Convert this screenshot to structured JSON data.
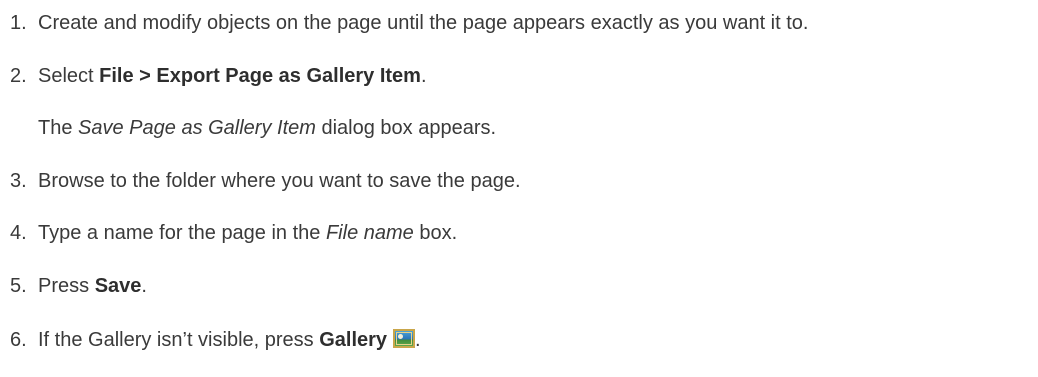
{
  "steps": [
    {
      "number": "1.",
      "text": "Create and modify objects on the page until the page appears exactly as you want it to."
    },
    {
      "number": "2.",
      "prefix": "Select ",
      "bold": "File > Export Page as Gallery Item",
      "suffix": ".",
      "note_prefix": "The ",
      "note_italic": "Save Page as Gallery Item",
      "note_suffix": " dialog box appears."
    },
    {
      "number": "3.",
      "text": "Browse to the folder where you want to save the page."
    },
    {
      "number": "4.",
      "prefix": "Type a name for the page in the ",
      "italic": "File name",
      "suffix": " box."
    },
    {
      "number": "5.",
      "prefix": "Press ",
      "bold": "Save",
      "suffix": "."
    },
    {
      "number": "6.",
      "prefix": "If the Gallery isn’t visible, press ",
      "bold": "Gallery",
      "icon": "gallery-icon",
      "suffix": "."
    }
  ]
}
